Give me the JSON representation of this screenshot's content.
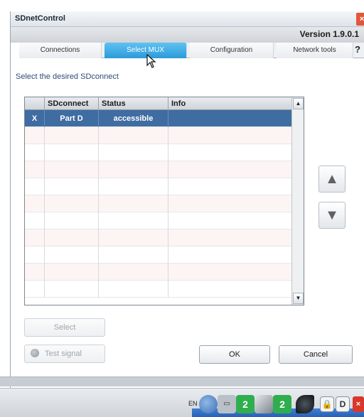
{
  "window": {
    "title": "SDnetControl",
    "close_glyph": "×",
    "version": "Version 1.9.0.1"
  },
  "tabs": [
    {
      "label": "Connections",
      "active": false
    },
    {
      "label": "Select MUX",
      "active": true
    },
    {
      "label": "Configuration",
      "active": false
    },
    {
      "label": "Network tools",
      "active": false
    }
  ],
  "help_glyph": "?",
  "main": {
    "prompt": "Select the desired SDconnect"
  },
  "grid": {
    "columns": [
      "",
      "SDconnect",
      "Status",
      "Info"
    ],
    "rows": [
      {
        "mark": "X",
        "sdconnect": "Part D",
        "status": "accessible",
        "info": "",
        "selected": true
      }
    ],
    "empty_row_count": 10
  },
  "move_buttons": {
    "up_glyph": "▲",
    "down_glyph": "▼"
  },
  "buttons": {
    "select": "Select",
    "test_signal": "Test signal",
    "ok": "OK",
    "cancel": "Cancel"
  },
  "taskbar": {
    "language": "EN",
    "icons": [
      "network-icon",
      "monitor-icon",
      "green-app-icon",
      "pen-tool-icon",
      "green-app-icon-2",
      "plug-icon",
      "lock-icon",
      "d-key-icon",
      "close-red-icon"
    ],
    "lock_glyph": "🔒",
    "d_label": "D",
    "close_glyph": "×"
  },
  "colors": {
    "active_tab": "#2c9ad8",
    "selected_row": "#3f6da2",
    "prompt_text": "#2f4a7a"
  }
}
